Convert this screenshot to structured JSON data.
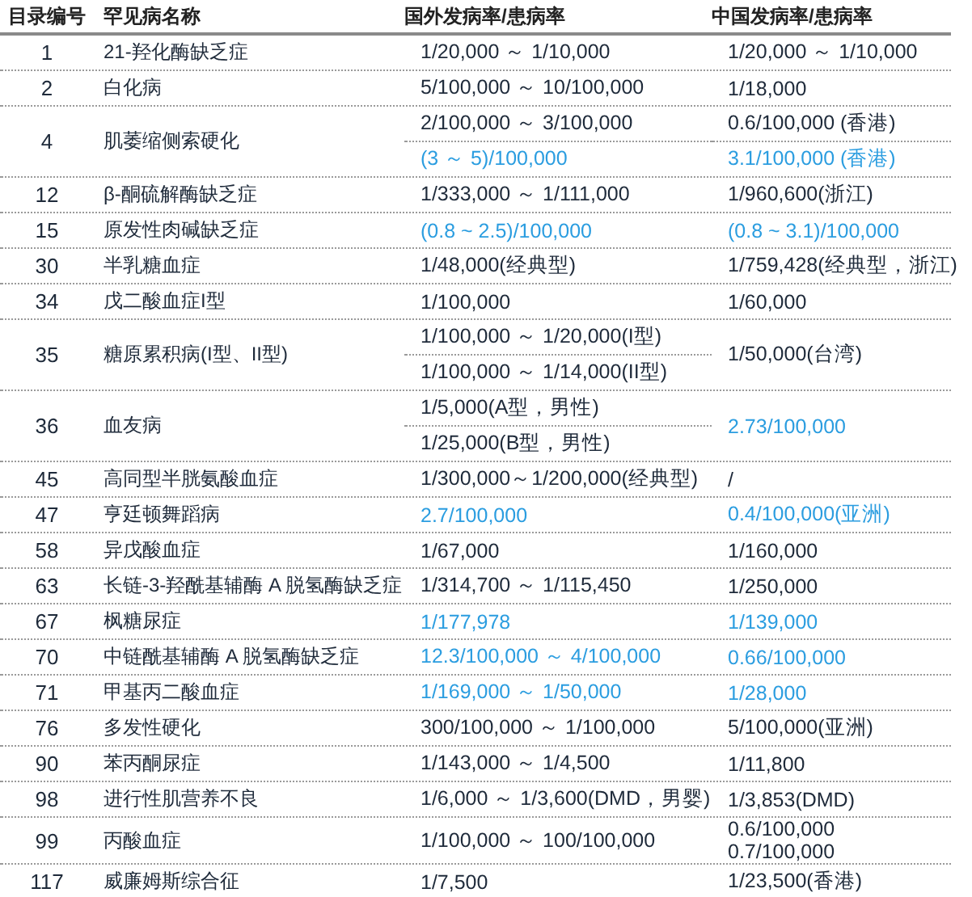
{
  "table": {
    "columns": [
      "目录编号",
      "罕见病名称",
      "国外发病率/患病率",
      "中国发病率/患病率"
    ],
    "rows": [
      {
        "number": "1",
        "name": "21-羟化酶缺乏症",
        "foreign": [
          {
            "text": "1/20,000 ～ 1/10,000",
            "highlight": false
          }
        ],
        "china": [
          {
            "text": "1/20,000 ～ 1/10,000",
            "highlight": false
          }
        ]
      },
      {
        "number": "2",
        "name": "白化病",
        "foreign": [
          {
            "text": "5/100,000 ～ 10/100,000",
            "highlight": false
          }
        ],
        "china": [
          {
            "text": "1/18,000",
            "highlight": false
          }
        ]
      },
      {
        "number": "4",
        "name": "肌萎缩侧索硬化",
        "foreign": [
          {
            "text": "2/100,000 ～ 3/100,000",
            "highlight": false
          },
          {
            "text": "(3 ～ 5)/100,000",
            "highlight": true
          }
        ],
        "china": [
          {
            "text": "0.6/100,000 (香港)",
            "highlight": false
          },
          {
            "text": "3.1/100,000 (香港)",
            "highlight": true
          }
        ]
      },
      {
        "number": "12",
        "name": "β-酮硫解酶缺乏症",
        "foreign": [
          {
            "text": "1/333,000 ～ 1/111,000",
            "highlight": false
          }
        ],
        "china": [
          {
            "text": "1/960,600(浙江)",
            "highlight": false
          }
        ]
      },
      {
        "number": "15",
        "name": "原发性肉碱缺乏症",
        "foreign": [
          {
            "text": "(0.8 ~ 2.5)/100,000",
            "highlight": true
          }
        ],
        "china": [
          {
            "text": "(0.8 ~ 3.1)/100,000",
            "highlight": true
          }
        ]
      },
      {
        "number": "30",
        "name": "半乳糖血症",
        "foreign": [
          {
            "text": "1/48,000(经典型)",
            "highlight": false
          }
        ],
        "china": [
          {
            "text": "1/759,428(经典型，浙江)",
            "highlight": false
          }
        ]
      },
      {
        "number": "34",
        "name": "戊二酸血症I型",
        "foreign": [
          {
            "text": "1/100,000",
            "highlight": false
          }
        ],
        "china": [
          {
            "text": "1/60,000",
            "highlight": false
          }
        ]
      },
      {
        "number": "35",
        "name": "糖原累积病(I型、II型)",
        "foreign": [
          {
            "text": "1/100,000 ～ 1/20,000(I型)",
            "highlight": false
          },
          {
            "text": "1/100,000 ～ 1/14,000(II型)",
            "highlight": false
          }
        ],
        "china": [
          {
            "text": "1/50,000(台湾)",
            "highlight": false
          }
        ]
      },
      {
        "number": "36",
        "name": "血友病",
        "foreign": [
          {
            "text": "1/5,000(A型，男性)",
            "highlight": false
          },
          {
            "text": "1/25,000(B型，男性)",
            "highlight": false
          }
        ],
        "china": [
          {
            "text": "2.73/100,000",
            "highlight": true
          }
        ]
      },
      {
        "number": "45",
        "name": "高同型半胱氨酸血症",
        "foreign": [
          {
            "text": "1/300,000～1/200,000(经典型)",
            "highlight": false
          }
        ],
        "china": [
          {
            "text": "/",
            "highlight": false
          }
        ]
      },
      {
        "number": "47",
        "name": "亨廷顿舞蹈病",
        "foreign": [
          {
            "text": "2.7/100,000",
            "highlight": true
          }
        ],
        "china": [
          {
            "text": "0.4/100,000(亚洲)",
            "highlight": true
          }
        ]
      },
      {
        "number": "58",
        "name": "异戊酸血症",
        "foreign": [
          {
            "text": "1/67,000",
            "highlight": false
          }
        ],
        "china": [
          {
            "text": "1/160,000",
            "highlight": false
          }
        ]
      },
      {
        "number": "63",
        "name": "长链-3-羟酰基辅酶 A 脱氢酶缺乏症",
        "foreign": [
          {
            "text": "1/314,700 ～ 1/115,450",
            "highlight": false
          }
        ],
        "china": [
          {
            "text": "1/250,000",
            "highlight": false
          }
        ]
      },
      {
        "number": "67",
        "name": "枫糖尿症",
        "foreign": [
          {
            "text": "1/177,978",
            "highlight": true
          }
        ],
        "china": [
          {
            "text": "1/139,000",
            "highlight": true
          }
        ]
      },
      {
        "number": "70",
        "name": "中链酰基辅酶 A 脱氢酶缺乏症",
        "foreign": [
          {
            "text": "12.3/100,000 ～ 4/100,000",
            "highlight": true
          }
        ],
        "china": [
          {
            "text": "0.66/100,000",
            "highlight": true
          }
        ]
      },
      {
        "number": "71",
        "name": "甲基丙二酸血症",
        "foreign": [
          {
            "text": "1/169,000 ～ 1/50,000",
            "highlight": true
          }
        ],
        "china": [
          {
            "text": "1/28,000",
            "highlight": true
          }
        ]
      },
      {
        "number": "76",
        "name": "多发性硬化",
        "foreign": [
          {
            "text": "300/100,000 ～ 1/100,000",
            "highlight": false
          }
        ],
        "china": [
          {
            "text": "5/100,000(亚洲)",
            "highlight": false
          }
        ]
      },
      {
        "number": "90",
        "name": "苯丙酮尿症",
        "foreign": [
          {
            "text": "1/143,000 ～ 1/4,500",
            "highlight": false
          }
        ],
        "china": [
          {
            "text": "1/11,800",
            "highlight": false
          }
        ]
      },
      {
        "number": "98",
        "name": "进行性肌营养不良",
        "foreign": [
          {
            "text": "1/6,000 ～ 1/3,600(DMD，男婴)",
            "highlight": false
          }
        ],
        "china": [
          {
            "text": "1/3,853(DMD)",
            "highlight": false
          }
        ]
      },
      {
        "number": "99",
        "name": "丙酸血症",
        "foreign": [
          {
            "text": "1/100,000 ～ 100/100,000",
            "highlight": false
          }
        ],
        "china": [
          {
            "text": "0.6/100,000",
            "highlight": false
          },
          {
            "text": "0.7/100,000",
            "highlight": false
          }
        ],
        "china_wrapped": true
      },
      {
        "number": "117",
        "name": "威廉姆斯综合征",
        "foreign": [
          {
            "text": "1/7,500",
            "highlight": false
          }
        ],
        "china": [
          {
            "text": "1/23,500(香港)",
            "highlight": false
          }
        ]
      }
    ]
  }
}
